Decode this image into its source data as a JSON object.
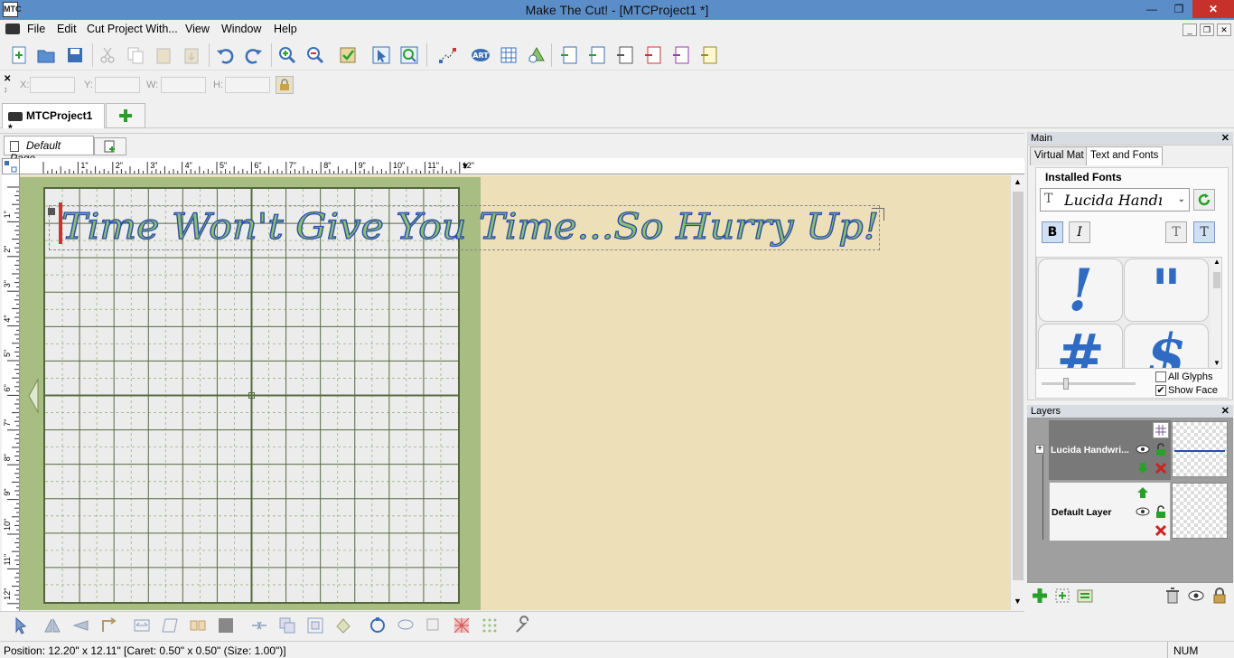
{
  "window": {
    "title": "Make The Cut! - [MTCProject1 *]",
    "app_icon": "MTC"
  },
  "menu": [
    "File",
    "Edit",
    "Cut Project With...",
    "View",
    "Window",
    "Help"
  ],
  "coords": {
    "x_label": "X:",
    "y_label": "Y:",
    "w_label": "W:",
    "h_label": "H:"
  },
  "project_tab": {
    "label": "MTCProject1 *"
  },
  "page_tab": {
    "label": "Default Page"
  },
  "ruler": {
    "h_ticks": [
      "1\"",
      "2\"",
      "3\"",
      "4\"",
      "5\"",
      "6\"",
      "7\"",
      "8\"",
      "9\"",
      "10\"",
      "11\"",
      "12\""
    ],
    "v_ticks": [
      "1\"",
      "2\"",
      "3\"",
      "4\"",
      "5\"",
      "6\"",
      "7\"",
      "8\"",
      "9\"",
      "10\"",
      "11\"",
      "12\""
    ]
  },
  "canvas_text": "Time Won't Give You Time...So Hurry Up!",
  "main_panel": {
    "title": "Main",
    "tabs": [
      "Virtual Mat",
      "Text and Fonts"
    ],
    "installed_fonts_label": "Installed Fonts",
    "font_selected": "Lucida Handı",
    "bold_label": "B",
    "italic_label": "I",
    "glyphs": [
      "!",
      "\"",
      "#",
      "$"
    ],
    "all_glyphs_label": "All Glyphs",
    "show_face_label": "Show Face",
    "all_glyphs_checked": false,
    "show_face_checked": true
  },
  "layers_panel": {
    "title": "Layers",
    "layers": [
      {
        "name": "Lucida Handwri..."
      },
      {
        "name": "Default Layer"
      }
    ]
  },
  "status": {
    "text": "Position: 12.20\" x 12.11\" [Caret: 0.50\" x 0.50\" (Size: 1.00\")]",
    "num": "NUM"
  },
  "colors": {
    "mat_green": "#a8bd82",
    "canvas_bg": "#ede0b8",
    "text_fill": "#8cc06e",
    "text_stroke": "#2b4fa8",
    "titlebar": "#5b8ec8"
  }
}
